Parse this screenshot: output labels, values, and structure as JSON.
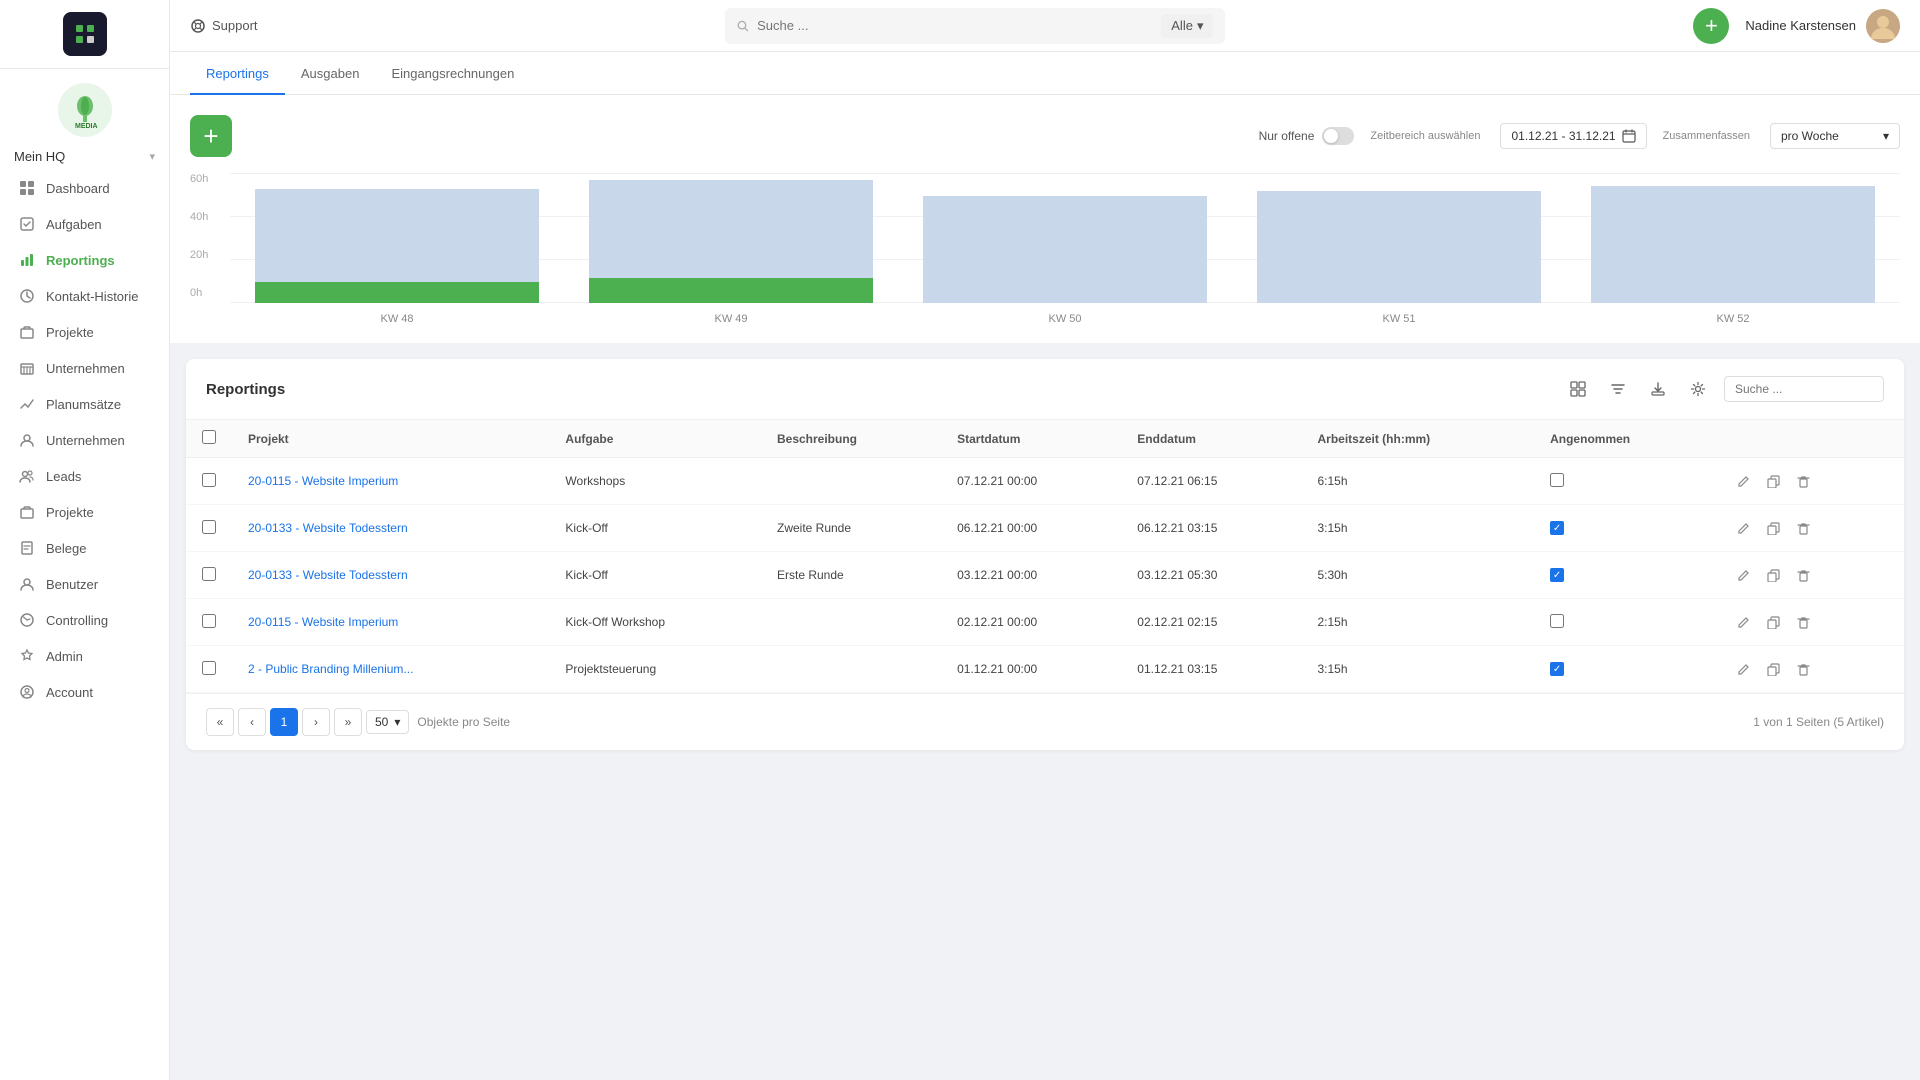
{
  "topbar": {
    "support_label": "Support",
    "search_placeholder": "Suche ...",
    "filter_label": "Alle",
    "add_btn_label": "+",
    "user_name": "Nadine Karstensen"
  },
  "sidebar": {
    "menu_label": "Mein HQ",
    "items": [
      {
        "id": "dashboard",
        "label": "Dashboard",
        "icon": "grid"
      },
      {
        "id": "aufgaben",
        "label": "Aufgaben",
        "icon": "check"
      },
      {
        "id": "reportings",
        "label": "Reportings",
        "icon": "chart",
        "active": true
      },
      {
        "id": "kontakt-historie",
        "label": "Kontakt-Historie",
        "icon": "clock"
      },
      {
        "id": "projekte-top",
        "label": "Projekte",
        "icon": "folder"
      },
      {
        "id": "unternehmen-top",
        "label": "Unternehmen",
        "icon": "building"
      },
      {
        "id": "planumsaetze",
        "label": "Planumsätze",
        "icon": "trending"
      },
      {
        "id": "unternehmen",
        "label": "Unternehmen",
        "icon": "building2"
      },
      {
        "id": "leads",
        "label": "Leads",
        "icon": "users"
      },
      {
        "id": "projekte",
        "label": "Projekte",
        "icon": "folder2"
      },
      {
        "id": "belege",
        "label": "Belege",
        "icon": "file"
      },
      {
        "id": "benutzer",
        "label": "Benutzer",
        "icon": "person"
      },
      {
        "id": "controlling",
        "label": "Controlling",
        "icon": "pie"
      },
      {
        "id": "admin",
        "label": "Admin",
        "icon": "shield"
      },
      {
        "id": "account",
        "label": "Account",
        "icon": "account"
      }
    ]
  },
  "tabs": [
    {
      "id": "reportings",
      "label": "Reportings",
      "active": true
    },
    {
      "id": "ausgaben",
      "label": "Ausgaben",
      "active": false
    },
    {
      "id": "eingangsrechnungen",
      "label": "Eingangsrechnungen",
      "active": false
    }
  ],
  "chart": {
    "y_labels": [
      "60h",
      "40h",
      "20h",
      "0h"
    ],
    "bars": [
      {
        "week": "KW 48",
        "top_pct": 45,
        "bottom_pct": 12
      },
      {
        "week": "KW 49",
        "top_pct": 58,
        "bottom_pct": 14
      },
      {
        "week": "KW 50",
        "top_pct": 50,
        "bottom_pct": 0
      },
      {
        "week": "KW 51",
        "top_pct": 52,
        "bottom_pct": 0
      },
      {
        "week": "KW 52",
        "top_pct": 55,
        "bottom_pct": 0
      }
    ],
    "nur_offene_label": "Nur offene",
    "zeitbereich_label": "Zeitbereich auswählen",
    "date_range": "01.12.21 - 31.12.21",
    "zusammenfassen_label": "Zusammenfassen",
    "pro_woche_label": "pro Woche"
  },
  "table": {
    "title": "Reportings",
    "search_placeholder": "Suche ...",
    "columns": [
      "Projekt",
      "Aufgabe",
      "Beschreibung",
      "Startdatum",
      "Enddatum",
      "Arbeitszeit (hh:mm)",
      "Angenommen"
    ],
    "rows": [
      {
        "id": 1,
        "projekt": "20-0115 - Website Imperium",
        "aufgabe": "Workshops",
        "beschreibung": "",
        "startdatum": "07.12.21 00:00",
        "enddatum": "07.12.21 06:15",
        "arbeitszeit": "6:15h",
        "angenommen": false,
        "checked": false
      },
      {
        "id": 2,
        "projekt": "20-0133 - Website Todesstern",
        "aufgabe": "Kick-Off",
        "beschreibung": "Zweite Runde",
        "startdatum": "06.12.21 00:00",
        "enddatum": "06.12.21 03:15",
        "arbeitszeit": "3:15h",
        "angenommen": true,
        "checked": false
      },
      {
        "id": 3,
        "projekt": "20-0133 - Website Todesstern",
        "aufgabe": "Kick-Off",
        "beschreibung": "Erste Runde",
        "startdatum": "03.12.21 00:00",
        "enddatum": "03.12.21 05:30",
        "arbeitszeit": "5:30h",
        "angenommen": true,
        "checked": false
      },
      {
        "id": 4,
        "projekt": "20-0115 - Website Imperium",
        "aufgabe": "Kick-Off Workshop",
        "beschreibung": "",
        "startdatum": "02.12.21 00:00",
        "enddatum": "02.12.21 02:15",
        "arbeitszeit": "2:15h",
        "angenommen": false,
        "checked": false
      },
      {
        "id": 5,
        "projekt": "2 - Public Branding Millenium...",
        "aufgabe": "Projektsteuerung",
        "beschreibung": "",
        "startdatum": "01.12.21 00:00",
        "enddatum": "01.12.21 03:15",
        "arbeitszeit": "3:15h",
        "angenommen": true,
        "checked": false
      }
    ],
    "pagination": {
      "current_page": 1,
      "total_pages": 1,
      "per_page": 50,
      "total_info": "1 von 1 Seiten (5 Artikel)",
      "objects_per_page_label": "Objekte pro Seite"
    }
  }
}
